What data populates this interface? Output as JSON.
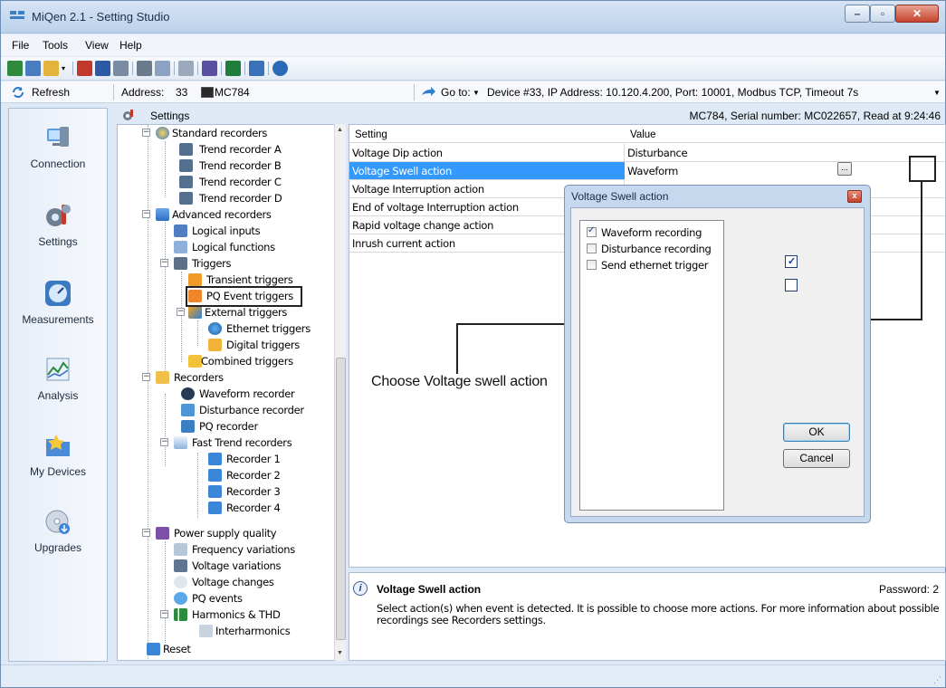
{
  "window": {
    "title": "MiQen 2.1 - Setting Studio"
  },
  "menu": [
    {
      "label": "File"
    },
    {
      "label": "Tools"
    },
    {
      "label": "View"
    },
    {
      "label": "Help"
    }
  ],
  "addressbar": {
    "refresh_label": "Refresh",
    "address_label": "Address:",
    "address_value": "33",
    "device": "MC784",
    "goto_label": "Go to:",
    "goto_value": "Device #33, IP Address: 10.120.4.200, Port: 10001, Modbus TCP, Timeout 7s"
  },
  "sidebar": [
    {
      "label": "Connection"
    },
    {
      "label": "Settings"
    },
    {
      "label": "Measurements"
    },
    {
      "label": "Analysis"
    },
    {
      "label": "My Devices"
    },
    {
      "label": "Upgrades"
    }
  ],
  "settings": {
    "title": "Settings",
    "device_info": "MC784, Serial number: MC022657, Read at 9:24:46"
  },
  "tree": [
    {
      "label": "Standard recorders"
    },
    {
      "label": "Trend recorder A"
    },
    {
      "label": "Trend recorder B"
    },
    {
      "label": "Trend recorder C"
    },
    {
      "label": "Trend recorder D"
    },
    {
      "label": "Advanced recorders"
    },
    {
      "label": "Logical inputs"
    },
    {
      "label": "Logical functions"
    },
    {
      "label": "Triggers"
    },
    {
      "label": "Transient triggers"
    },
    {
      "label": "PQ Event triggers"
    },
    {
      "label": "External triggers"
    },
    {
      "label": "Ethernet triggers"
    },
    {
      "label": "Digital triggers"
    },
    {
      "label": "Combined triggers"
    },
    {
      "label": "Recorders"
    },
    {
      "label": "Waveform recorder"
    },
    {
      "label": "Disturbance recorder"
    },
    {
      "label": "PQ recorder"
    },
    {
      "label": "Fast Trend recorders"
    },
    {
      "label": "Recorder 1"
    },
    {
      "label": "Recorder 2"
    },
    {
      "label": "Recorder 3"
    },
    {
      "label": "Recorder 4"
    },
    {
      "label": "Power supply quality"
    },
    {
      "label": "Frequency variations"
    },
    {
      "label": "Voltage variations"
    },
    {
      "label": "Voltage changes"
    },
    {
      "label": "PQ events"
    },
    {
      "label": "Harmonics & THD"
    },
    {
      "label": "Interharmonics"
    },
    {
      "label": "Reset"
    }
  ],
  "grid": {
    "col_setting": "Setting",
    "col_value": "Value",
    "rows": [
      {
        "setting": "Voltage Dip action",
        "value": "Disturbance"
      },
      {
        "setting": "Voltage Swell action",
        "value": "Waveform"
      },
      {
        "setting": "Voltage Interruption action",
        "value": ""
      },
      {
        "setting": "End of voltage Interruption action",
        "value": ""
      },
      {
        "setting": "Rapid voltage change action",
        "value": ""
      },
      {
        "setting": "Inrush current action",
        "value": ""
      }
    ],
    "ellipsis": "..."
  },
  "dialog": {
    "title": "Voltage Swell action",
    "close": "x",
    "options": [
      {
        "label": "Waveform recording",
        "checked": true
      },
      {
        "label": "Disturbance recording",
        "checked": false
      },
      {
        "label": "Send ethernet trigger",
        "checked": false
      }
    ],
    "ok_label": "OK",
    "cancel_label": "Cancel"
  },
  "callout": {
    "text": "Choose Voltage swell action"
  },
  "info": {
    "title": "Voltage Swell action",
    "password": "Password: 2",
    "description": "Select action(s) when event is detected. It is possible to choose more actions. For more information about possible recordings see Recorders settings."
  }
}
